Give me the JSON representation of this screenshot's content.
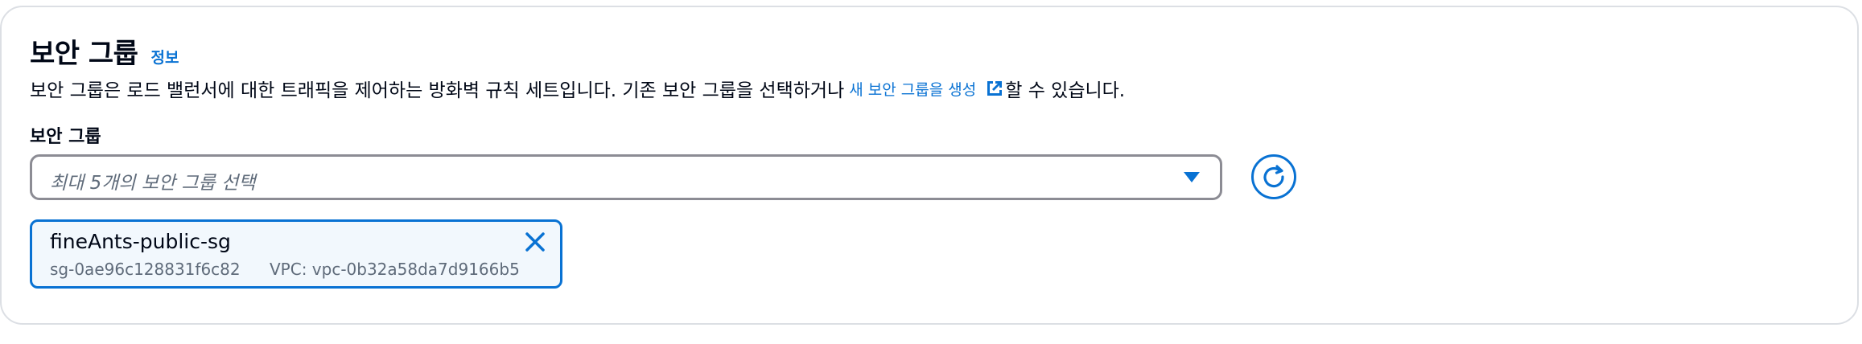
{
  "panel": {
    "title": "보안 그룹",
    "info_link": "정보",
    "description_before": "보안 그룹은 로드 밸런서에 대한 트래픽을 제어하는 방화벽 규칙 세트입니다. 기존 보안 그룹을 선택하거나",
    "create_link": "새 보안 그룹을 생성",
    "description_after": "할 수 있습니다."
  },
  "field": {
    "label": "보안 그룹",
    "placeholder": "최대 5개의 보안 그룹 선택"
  },
  "selected_groups": [
    {
      "name": "fineAnts-public-sg",
      "id": "sg-0ae96c128831f6c82",
      "vpc": "VPC: vpc-0b32a58da7d9166b5"
    }
  ],
  "icons": {
    "external": "external-link-icon",
    "caret": "caret-down-icon",
    "refresh": "refresh-icon",
    "remove": "close-icon"
  },
  "colors": {
    "accent": "#0972d3",
    "text": "#000716",
    "muted": "#5f6b7a",
    "token_bg": "#f2f8fd",
    "border": "#8c8c94"
  }
}
